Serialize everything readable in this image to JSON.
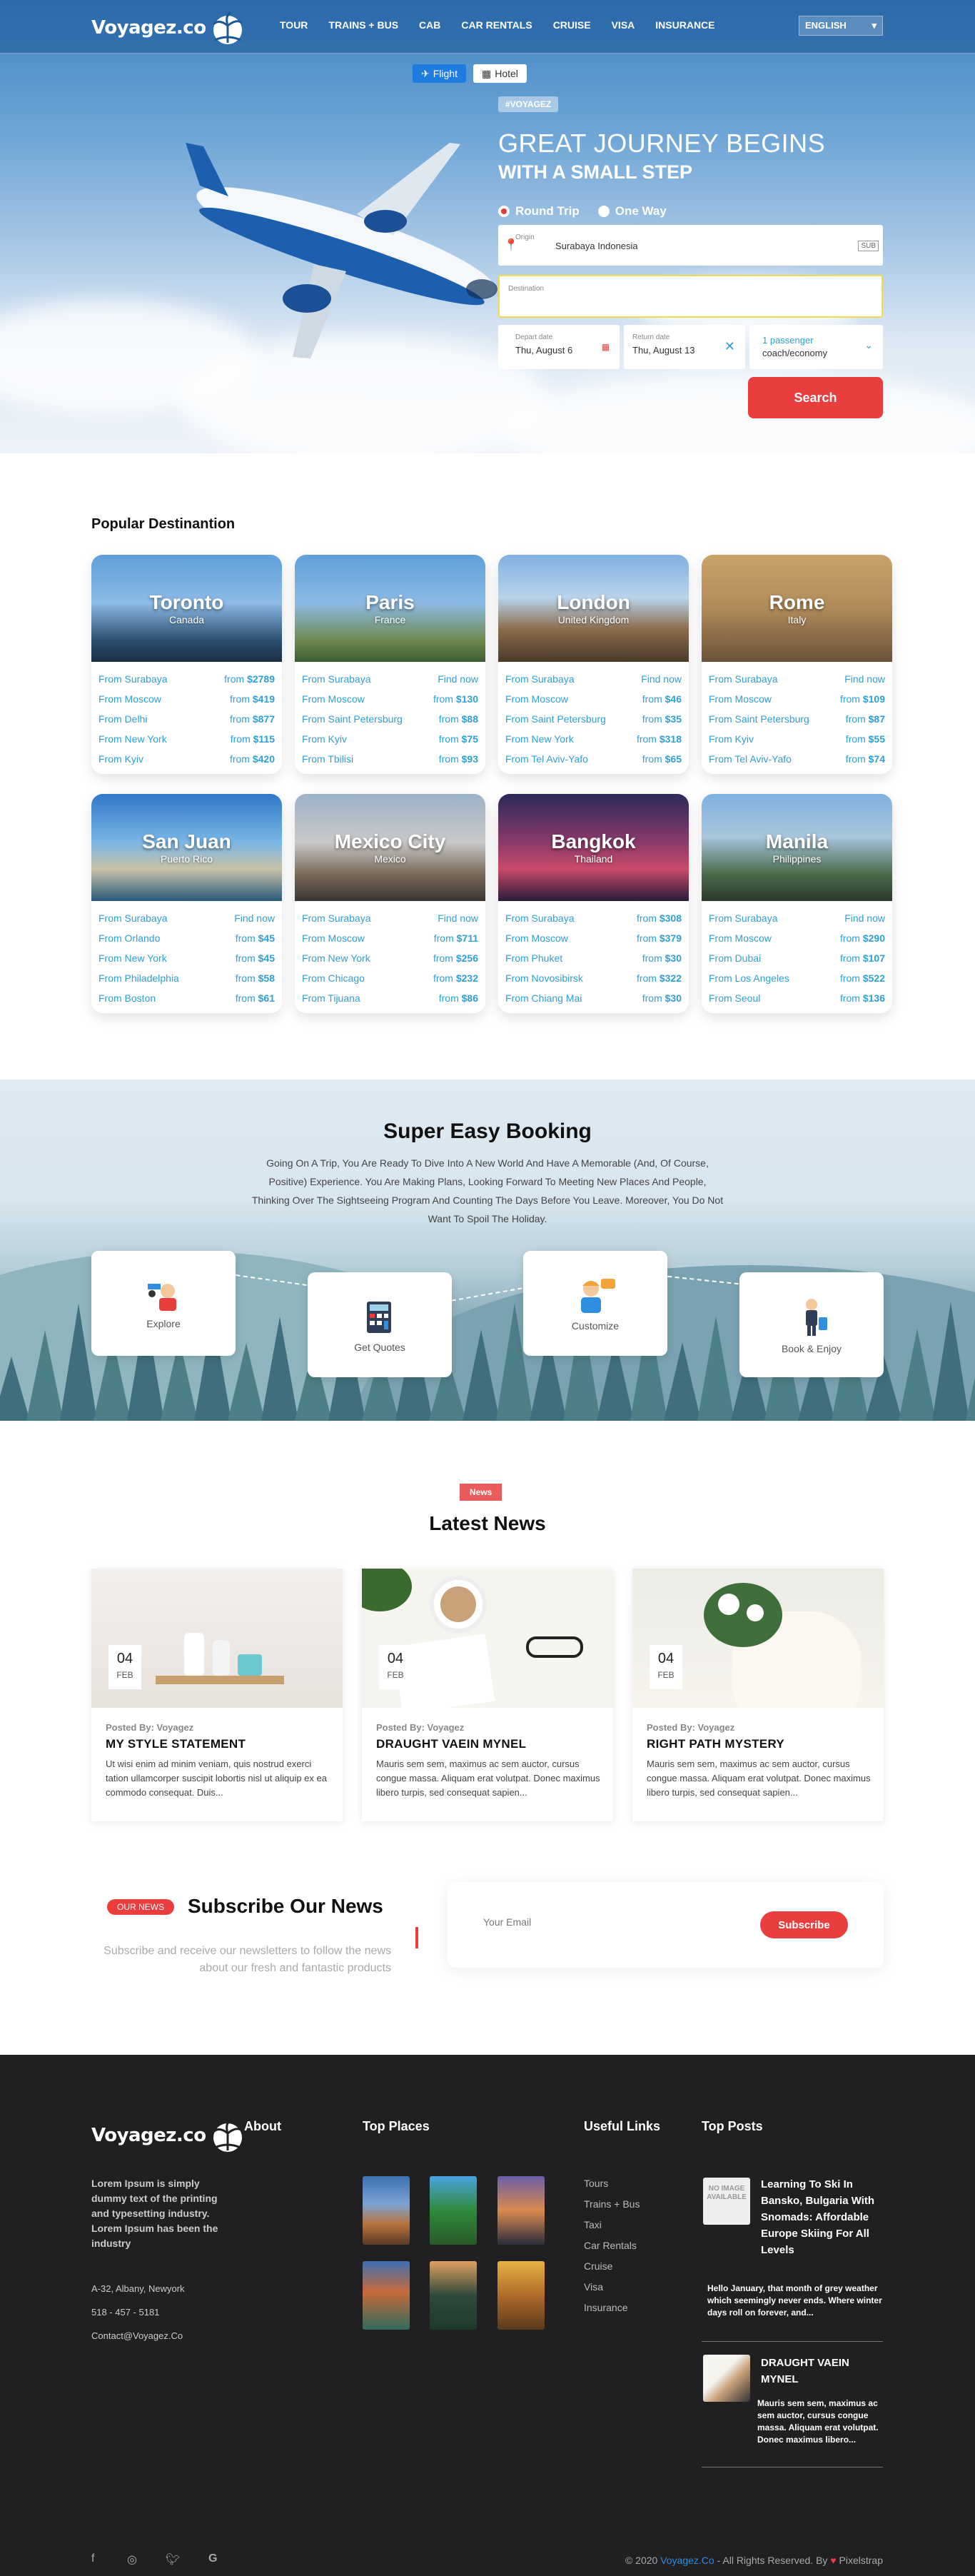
{
  "header": {
    "logo": "Voyagez.co",
    "nav": [
      "TOUR",
      "TRAINS + BUS",
      "CAB",
      "CAR RENTALS",
      "CRUISE",
      "VISA",
      "INSURANCE"
    ],
    "language": "ENGLISH"
  },
  "hero": {
    "tabs": [
      "Flight",
      "Hotel"
    ],
    "tag": "#VOYAGEZ",
    "title": "GREAT JOURNEY BEGINS",
    "subtitle": "WITH A SMALL STEP",
    "trip_types": [
      "Round Trip",
      "One Way"
    ],
    "origin_label": "Origin",
    "origin_value": "Surabaya Indonesia",
    "origin_code": "SUB",
    "destination_label": "Destination",
    "depart_label": "Depart date",
    "depart_value": "Thu, August 6",
    "return_label": "Return date",
    "return_value": "Thu, August 13",
    "passenger_label": "1 passenger",
    "passenger_value": "coach/economy",
    "search_button": "Search"
  },
  "popular": {
    "title": "Popular Destinantion",
    "cards": [
      {
        "city": "Toronto",
        "country": "Canada",
        "rows": [
          [
            "From Surabaya",
            "from ",
            "$2789"
          ],
          [
            "From Moscow",
            "from ",
            "$419"
          ],
          [
            "From Delhi",
            "from ",
            "$877"
          ],
          [
            "From New York",
            "from ",
            "$115"
          ],
          [
            "From Kyiv",
            "from ",
            "$420"
          ]
        ]
      },
      {
        "city": "Paris",
        "country": "France",
        "rows": [
          [
            "From Surabaya",
            "Find now",
            ""
          ],
          [
            "From Moscow",
            "from ",
            "$130"
          ],
          [
            "From Saint Petersburg",
            "from ",
            "$88"
          ],
          [
            "From Kyiv",
            "from ",
            "$75"
          ],
          [
            "From Tbilisi",
            "from ",
            "$93"
          ]
        ]
      },
      {
        "city": "London",
        "country": "United Kingdom",
        "rows": [
          [
            "From Surabaya",
            "Find now",
            ""
          ],
          [
            "From Moscow",
            "from ",
            "$46"
          ],
          [
            "From Saint Petersburg",
            "from ",
            "$35"
          ],
          [
            "From New York",
            "from ",
            "$318"
          ],
          [
            "From Tel Aviv-Yafo",
            "from ",
            "$65"
          ]
        ]
      },
      {
        "city": "Rome",
        "country": "Italy",
        "rows": [
          [
            "From Surabaya",
            "Find now",
            ""
          ],
          [
            "From Moscow",
            "from ",
            "$109"
          ],
          [
            "From Saint Petersburg",
            "from ",
            "$87"
          ],
          [
            "From Kyiv",
            "from ",
            "$55"
          ],
          [
            "From Tel Aviv-Yafo",
            "from ",
            "$74"
          ]
        ]
      },
      {
        "city": "San Juan",
        "country": "Puerto Rico",
        "rows": [
          [
            "From Surabaya",
            "Find now",
            ""
          ],
          [
            "From Orlando",
            "from ",
            "$45"
          ],
          [
            "From New York",
            "from ",
            "$45"
          ],
          [
            "From Philadelphia",
            "from ",
            "$58"
          ],
          [
            "From Boston",
            "from ",
            "$61"
          ]
        ]
      },
      {
        "city": "Mexico City",
        "country": "Mexico",
        "rows": [
          [
            "From Surabaya",
            "Find now",
            ""
          ],
          [
            "From Moscow",
            "from ",
            "$711"
          ],
          [
            "From New York",
            "from ",
            "$256"
          ],
          [
            "From Chicago",
            "from ",
            "$232"
          ],
          [
            "From Tijuana",
            "from ",
            "$86"
          ]
        ]
      },
      {
        "city": "Bangkok",
        "country": "Thailand",
        "rows": [
          [
            "From Surabaya",
            "from ",
            "$308"
          ],
          [
            "From Moscow",
            "from ",
            "$379"
          ],
          [
            "From Phuket",
            "from ",
            "$30"
          ],
          [
            "From Novosibirsk",
            "from ",
            "$322"
          ],
          [
            "From Chiang Mai",
            "from ",
            "$30"
          ]
        ]
      },
      {
        "city": "Manila",
        "country": "Philippines",
        "rows": [
          [
            "From Surabaya",
            "Find now",
            ""
          ],
          [
            "From Moscow",
            "from ",
            "$290"
          ],
          [
            "From Dubai",
            "from ",
            "$107"
          ],
          [
            "From Los Angeles",
            "from ",
            "$522"
          ],
          [
            "From Seoul",
            "from ",
            "$136"
          ]
        ]
      }
    ]
  },
  "booking": {
    "title": "Super Easy Booking",
    "text": "Going On A Trip, You Are Ready To Dive Into A New World And Have A Memorable (And, Of Course, Positive) Experience. You Are Making Plans, Looking Forward To Meeting New Places And People, Thinking Over The Sightseeing Program And Counting The Days Before You Leave. Moreover, You Do Not Want To Spoil The Holiday.",
    "steps": [
      "Explore",
      "Get Quotes",
      "Customize",
      "Book & Enjoy"
    ]
  },
  "news": {
    "pill": "News",
    "title": "Latest News",
    "items": [
      {
        "day": "04",
        "month": "FEB",
        "by": "Posted By: Voyagez",
        "title": "MY STYLE STATEMENT",
        "excerpt": "Ut wisi enim ad minim veniam, quis nostrud exerci tation ullamcorper suscipit lobortis nisl ut aliquip ex ea commodo consequat. Duis..."
      },
      {
        "day": "04",
        "month": "FEB",
        "by": "Posted By: Voyagez",
        "title": "DRAUGHT VAEIN MYNEL",
        "excerpt": "Mauris sem sem, maximus ac sem auctor, cursus congue massa. Aliquam erat volutpat. Donec maximus libero turpis, sed consequat sapien..."
      },
      {
        "day": "04",
        "month": "FEB",
        "by": "Posted By: Voyagez",
        "title": "RIGHT PATH MYSTERY",
        "excerpt": "Mauris sem sem, maximus ac sem auctor, cursus congue massa. Aliquam erat volutpat. Donec maximus libero turpis, sed consequat sapien..."
      }
    ]
  },
  "subscribe": {
    "pill": "OUR NEWS",
    "title": "Subscribe Our News",
    "text": "Subscribe and receive our newsletters to follow the news about our fresh and fantastic products",
    "placeholder": "Your Email",
    "button": "Subscribe"
  },
  "footer": {
    "logo": "Voyagez.co",
    "about_text": "Lorem Ipsum is simply dummy text of the printing and typesetting industry. Lorem Ipsum has been the industry",
    "address": "A-32, Albany, Newyork",
    "phone": "518 - 457 - 5181",
    "email": "Contact@Voyagez.Co",
    "headings": {
      "about": "About",
      "places": "Top Places",
      "links": "Useful Links",
      "posts": "Top Posts"
    },
    "links": [
      "Tours",
      "Trains + Bus",
      "Taxi",
      "Car Rentals",
      "Cruise",
      "Visa",
      "Insurance"
    ],
    "posts": [
      {
        "title": "Learning To Ski In Bansko, Bulgaria With Snomads: Affordable Europe Skiing For All Levels",
        "excerpt": "Hello January, that month of grey weather which seemingly never ends. Where winter days roll on forever, and..."
      },
      {
        "title": "DRAUGHT VAEIN MYNEL",
        "excerpt": "Mauris sem sem, maximus ac sem auctor, cursus congue massa. Aliquam erat volutpat. Donec maximus libero..."
      }
    ],
    "no_image": "NO IMAGE AVAILABLE",
    "copyright_prefix": "© 2020 ",
    "copyright_brand": "Voyagez.Co",
    "copyright_mid": " - All Rights Reserved. By ",
    "copyright_heart": "♥",
    "copyright_author": " Pixelstrap",
    "social_icons": [
      "facebook-icon",
      "instagram-icon",
      "twitter-icon",
      "google-icon"
    ]
  }
}
